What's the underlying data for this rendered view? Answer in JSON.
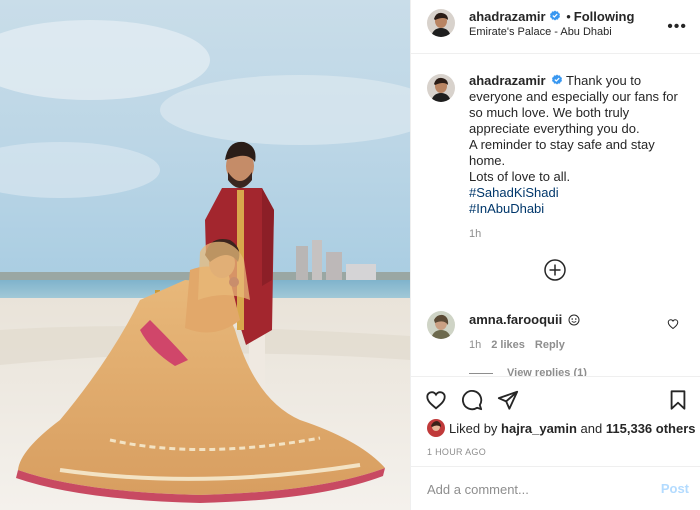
{
  "photo": {
    "alt": "Couple in wedding attire on a beach"
  },
  "header": {
    "username": "ahadrazamir",
    "separator": "•",
    "follow_status": "Following",
    "location": "Emirate's Palace - Abu Dhabi",
    "more_glyph": "•••"
  },
  "caption": {
    "username": "ahadrazamir",
    "lines": [
      "Thank you to everyone and especially our fans for so much love. We both truly appreciate everything you do.",
      "A reminder to stay safe and stay home.",
      "Lots of love to all."
    ],
    "hashtags": [
      "#SahadKiShadi",
      "#InAbuDhabi"
    ],
    "time": "1h"
  },
  "comment": {
    "username": "amna.farooquii",
    "time": "1h",
    "likes": "2 likes",
    "reply": "Reply",
    "view_replies": "View replies (1)"
  },
  "likes": {
    "prefix": "Liked by",
    "user": "hajra_yamin",
    "and": "and",
    "count": "115,336 others"
  },
  "timestamp": "1 HOUR AGO",
  "comment_box": {
    "placeholder": "Add a comment...",
    "post_label": "Post"
  },
  "colors": {
    "verified": "#3897f0",
    "link": "#00376b",
    "muted": "#8e8e8e",
    "post_disabled": "#b3dbff"
  },
  "icons": [
    "heart-icon",
    "comment-icon",
    "share-icon",
    "bookmark-icon",
    "add-icon",
    "verified-badge-icon",
    "smiley-icon"
  ]
}
